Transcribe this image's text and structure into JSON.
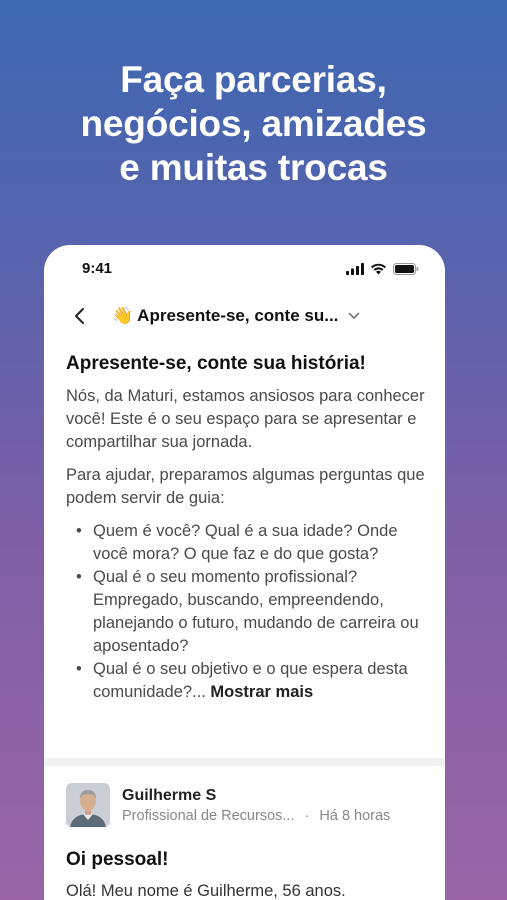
{
  "headline": {
    "line1": "Faça parcerias,",
    "line2": "negócios, amizades",
    "line3": "e muitas trocas"
  },
  "status_bar": {
    "time": "9:41",
    "icons": [
      "signal-icon",
      "wifi-icon",
      "battery-icon"
    ]
  },
  "nav": {
    "back_icon": "chevron-left-icon",
    "emoji": "👋",
    "title": "Apresente-se, conte su...",
    "dropdown_icon": "chevron-down-icon"
  },
  "post": {
    "title": "Apresente-se, conte sua história!",
    "para1": "Nós, da Maturi, estamos ansiosos para conhecer você! Este é o seu espaço para se apresentar e compartilhar sua jornada.",
    "para2": "Para ajudar, preparamos algumas perguntas que podem servir de guia:",
    "questions": [
      "Quem é você? Qual é a sua idade? Onde você mora? O que faz e do que gosta?",
      "Qual é o seu momento profissional? Empregado, buscando, empreendendo, planejando o futuro, mudando de carreira ou aposentado?",
      "Qual é o seu objetivo e o que espera desta comunidade?..."
    ],
    "show_more": "Mostrar mais"
  },
  "comment": {
    "author": "Guilherme S",
    "role": "Profissional de Recursos...",
    "separator": "·",
    "time": "Há 8 horas",
    "title": "Oi pessoal!",
    "body": "Olá! Meu nome é Guilherme, 56 anos."
  },
  "colors": {
    "gradient_top": "#3d67b1",
    "gradient_bottom": "#9a66a7",
    "card": "#ffffff"
  }
}
